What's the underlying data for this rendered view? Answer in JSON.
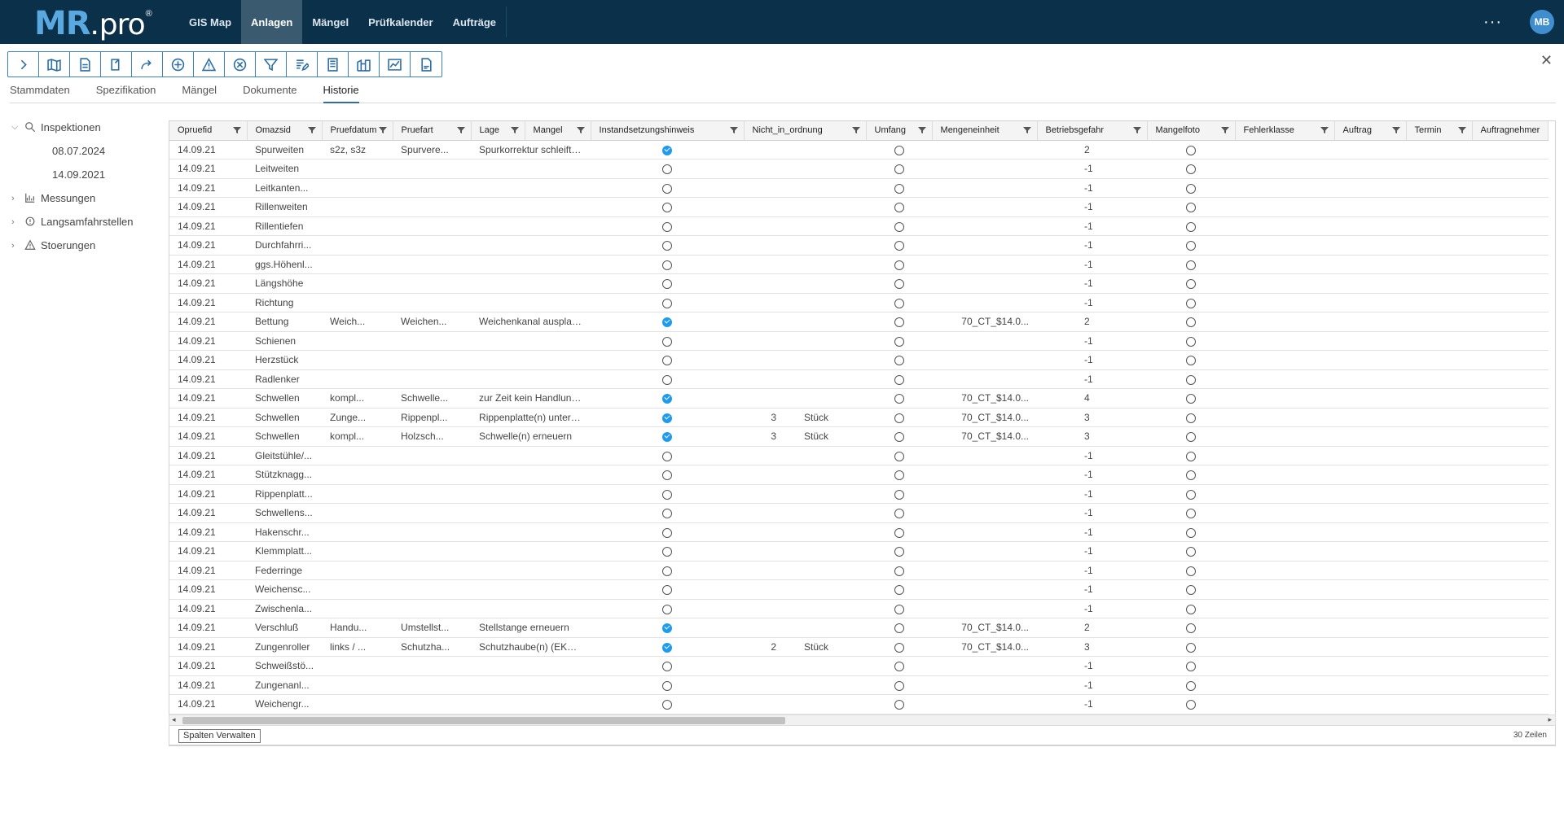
{
  "brand": {
    "mr": "MR",
    "dot": ".",
    "pro": "pro",
    "sup": "®"
  },
  "nav": {
    "items": [
      {
        "label": "GIS Map",
        "active": false
      },
      {
        "label": "Anlagen",
        "active": true
      },
      {
        "label": "Mängel",
        "active": false
      },
      {
        "label": "Prüfkalender",
        "active": false
      },
      {
        "label": "Aufträge",
        "active": false
      }
    ]
  },
  "user": {
    "initials": "MB",
    "more": "···"
  },
  "close_label": "✕",
  "tabs": [
    "Stammdaten",
    "Spezifikation",
    "Mängel",
    "Dokumente",
    "Historie"
  ],
  "active_tab": "Historie",
  "tree": {
    "inspektionen": "Inspektionen",
    "dates": [
      "08.07.2024",
      "14.09.2021"
    ],
    "messungen": "Messungen",
    "langsamfahrstellen": "Langsamfahrstellen",
    "stoerungen": "Stoerungen"
  },
  "columns": [
    "Opruefid",
    "Omazsid",
    "Pruefdatum",
    "Pruefart",
    "Lage",
    "Mangel",
    "Instandsetzungshinweis",
    "Nicht_in_ordnung",
    "Umfang",
    "Mengeneinheit",
    "Betriebsgefahr",
    "Mangelfoto",
    "Fehlerklasse",
    "Auftrag",
    "Termin",
    "Auftragnehmer"
  ],
  "rows": [
    [
      "14.09.21",
      "Spurweiten",
      "s2z, s3z",
      "Spurvere...",
      "Spurkorrektur schleiftechnis...",
      "1",
      "",
      "",
      "",
      "",
      "2",
      "0"
    ],
    [
      "14.09.21",
      "Leitweiten",
      "",
      "",
      "",
      "0",
      "",
      "",
      "",
      "",
      "-1",
      "0"
    ],
    [
      "14.09.21",
      "Leitkanten...",
      "",
      "",
      "",
      "0",
      "",
      "",
      "",
      "",
      "-1",
      "0"
    ],
    [
      "14.09.21",
      "Rillenweiten",
      "",
      "",
      "",
      "0",
      "",
      "",
      "",
      "",
      "-1",
      "0"
    ],
    [
      "14.09.21",
      "Rillentiefen",
      "",
      "",
      "",
      "0",
      "",
      "",
      "",
      "",
      "-1",
      "0"
    ],
    [
      "14.09.21",
      "Durchfahrri...",
      "",
      "",
      "",
      "0",
      "",
      "",
      "",
      "",
      "-1",
      "0"
    ],
    [
      "14.09.21",
      "ggs.Höhenl...",
      "",
      "",
      "",
      "0",
      "",
      "",
      "",
      "",
      "-1",
      "0"
    ],
    [
      "14.09.21",
      "Längshöhe",
      "",
      "",
      "",
      "0",
      "",
      "",
      "",
      "",
      "-1",
      "0"
    ],
    [
      "14.09.21",
      "Richtung",
      "",
      "",
      "",
      "0",
      "",
      "",
      "",
      "",
      "-1",
      "0"
    ],
    [
      "14.09.21",
      "Bettung",
      "Weich...",
      "Weichen...",
      "Weichenkanal ausplatten",
      "1",
      "",
      "",
      "0",
      "70_CT_$14.0...",
      "2",
      "0"
    ],
    [
      "14.09.21",
      "Schienen",
      "",
      "",
      "",
      "0",
      "",
      "",
      "",
      "",
      "-1",
      "0"
    ],
    [
      "14.09.21",
      "Herzstück",
      "",
      "",
      "",
      "0",
      "",
      "",
      "",
      "",
      "-1",
      "0"
    ],
    [
      "14.09.21",
      "Radlenker",
      "",
      "",
      "",
      "0",
      "",
      "",
      "",
      "",
      "-1",
      "0"
    ],
    [
      "14.09.21",
      "Schwellen",
      "kompl...",
      "Schwelle...",
      "zur Zeit kein Handlungsbed...",
      "1",
      "",
      "",
      "0",
      "70_CT_$14.0...",
      "4",
      "0"
    ],
    [
      "14.09.21",
      "Schwellen",
      "Zunge...",
      "Rippenpl...",
      "Rippenplatte(n) unterfüttern",
      "1",
      "3",
      "Stück",
      "0",
      "70_CT_$14.0...",
      "3",
      "0"
    ],
    [
      "14.09.21",
      "Schwellen",
      "kompl...",
      "Holzsch...",
      "Schwelle(n) erneuern",
      "1",
      "3",
      "Stück",
      "0",
      "70_CT_$14.0...",
      "3",
      "0"
    ],
    [
      "14.09.21",
      "Gleitstühle/...",
      "",
      "",
      "",
      "0",
      "",
      "",
      "",
      "",
      "-1",
      "0"
    ],
    [
      "14.09.21",
      "Stützknagg...",
      "",
      "",
      "",
      "0",
      "",
      "",
      "",
      "",
      "-1",
      "0"
    ],
    [
      "14.09.21",
      "Rippenplatt...",
      "",
      "",
      "",
      "0",
      "",
      "",
      "",
      "",
      "-1",
      "0"
    ],
    [
      "14.09.21",
      "Schwellens...",
      "",
      "",
      "",
      "0",
      "",
      "",
      "",
      "",
      "-1",
      "0"
    ],
    [
      "14.09.21",
      "Hakenschr...",
      "",
      "",
      "",
      "0",
      "",
      "",
      "",
      "",
      "-1",
      "0"
    ],
    [
      "14.09.21",
      "Klemmplatt...",
      "",
      "",
      "",
      "0",
      "",
      "",
      "",
      "",
      "-1",
      "0"
    ],
    [
      "14.09.21",
      "Federringe",
      "",
      "",
      "",
      "0",
      "",
      "",
      "",
      "",
      "-1",
      "0"
    ],
    [
      "14.09.21",
      "Weichensc...",
      "",
      "",
      "",
      "0",
      "",
      "",
      "",
      "",
      "-1",
      "0"
    ],
    [
      "14.09.21",
      "Zwischenla...",
      "",
      "",
      "",
      "0",
      "",
      "",
      "",
      "",
      "-1",
      "0"
    ],
    [
      "14.09.21",
      "Verschluß",
      "Handu...",
      "Umstellst...",
      "Stellstange erneuern",
      "1",
      "",
      "",
      "0",
      "70_CT_$14.0...",
      "2",
      "0"
    ],
    [
      "14.09.21",
      "Zungenroller",
      "links / ...",
      "Schutzha...",
      "Schutzhaube(n) (EKOS) ern...",
      "1",
      "2",
      "Stück",
      "0",
      "70_CT_$14.0...",
      "3",
      "0"
    ],
    [
      "14.09.21",
      "Schweißstö...",
      "",
      "",
      "",
      "0",
      "",
      "",
      "",
      "",
      "-1",
      "0"
    ],
    [
      "14.09.21",
      "Zungenanl...",
      "",
      "",
      "",
      "0",
      "",
      "",
      "",
      "",
      "-1",
      "0"
    ],
    [
      "14.09.21",
      "Weichengr...",
      "",
      "",
      "",
      "0",
      "",
      "",
      "",
      "",
      "-1",
      "0"
    ]
  ],
  "footer": {
    "manage_label": "Spalten Verwalten",
    "rows_count": "30 Zeilen"
  }
}
